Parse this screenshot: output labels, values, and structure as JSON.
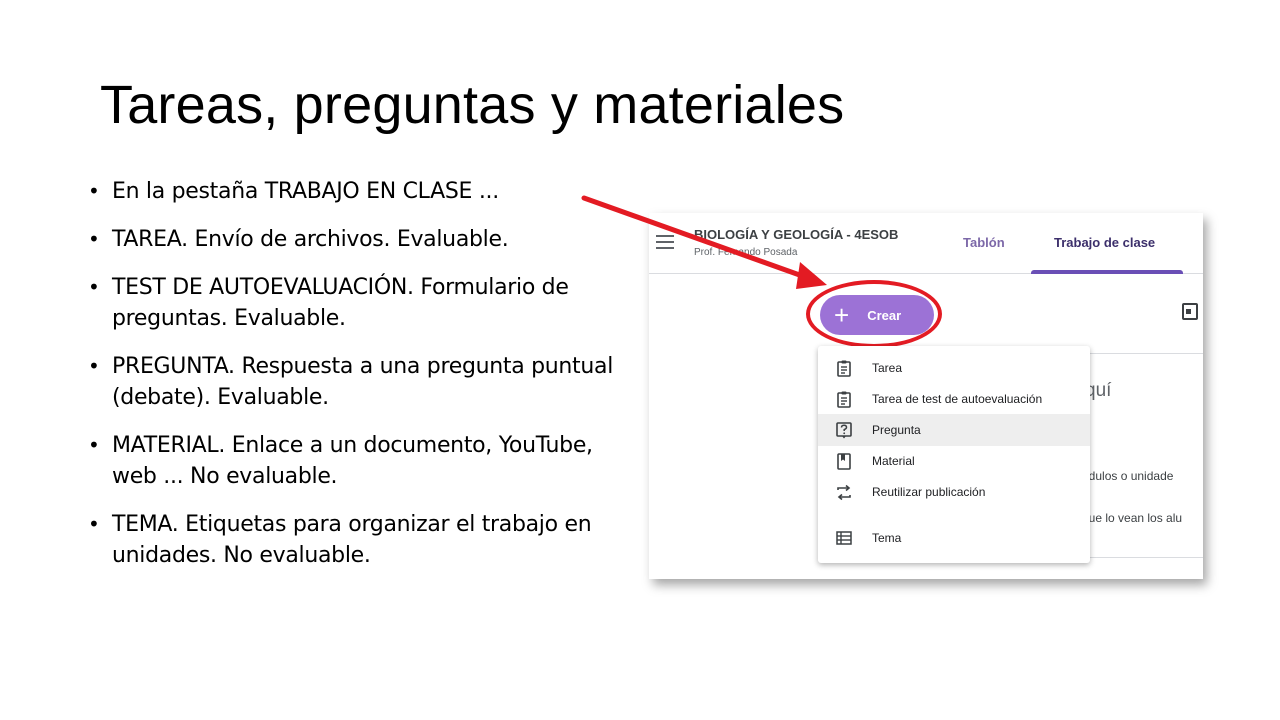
{
  "slide": {
    "title": "Tareas, preguntas y materiales",
    "bullets": [
      "En la pestaña TRABAJO EN CLASE ...",
      "TAREA. Envío de archivos. Evaluable.",
      "TEST DE AUTOEVALUACIÓN. Formulario de preguntas. Evaluable.",
      "PREGUNTA. Respuesta a una pregunta puntual (debate). Evaluable.",
      "MATERIAL. Enlace a un documento, YouTube, web ... No evaluable.",
      "TEMA. Etiquetas para organizar el trabajo en unidades. No evaluable."
    ]
  },
  "classroom": {
    "course_name": "BIOLOGÍA Y GEOLOGÍA - 4ESOB",
    "teacher": "Prof. Fernando Posada",
    "tabs": [
      {
        "label": "Tablón",
        "active": false
      },
      {
        "label": "Trabajo de clase",
        "active": true
      }
    ],
    "create_button": "Crear",
    "menu_items": [
      {
        "label": "Tarea",
        "icon": "assignment-icon"
      },
      {
        "label": "Tarea de test de autoevaluación",
        "icon": "quiz-assignment-icon"
      },
      {
        "label": "Pregunta",
        "icon": "question-icon"
      },
      {
        "label": "Material",
        "icon": "material-icon"
      },
      {
        "label": "Reutilizar publicación",
        "icon": "reuse-icon"
      },
      {
        "label": "Tema",
        "icon": "topic-icon"
      }
    ],
    "background_text": {
      "heading_fragment": "quí",
      "line1_fragment": "ódulos o unidade",
      "line2_fragment": "que lo vean los alu"
    }
  },
  "colors": {
    "create_button": "#9c72d6",
    "annotation": "#e31b23",
    "active_tab": "#6a4fb6"
  }
}
